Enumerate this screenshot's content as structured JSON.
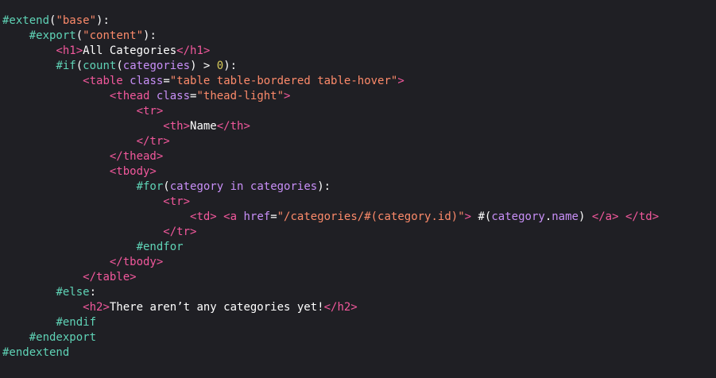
{
  "editor": {
    "background": "#1f1f24",
    "colors": {
      "directive": "#5fd3b6",
      "tag": "#f2589c",
      "string": "#fc8a6a",
      "attribute": "#c88ff7",
      "text": "#ffffff",
      "number": "#d6c85a"
    },
    "lines": [
      [
        [
          "dir",
          "#extend"
        ],
        [
          "pun",
          "("
        ],
        [
          "str",
          "\"base\""
        ],
        [
          "pun",
          "):"
        ]
      ],
      [
        [
          "pun",
          "    "
        ],
        [
          "dir",
          "#export"
        ],
        [
          "pun",
          "("
        ],
        [
          "str",
          "\"content\""
        ],
        [
          "pun",
          "):"
        ]
      ],
      [
        [
          "pun",
          "        "
        ],
        [
          "tag",
          "<h1>"
        ],
        [
          "txt",
          "All Categories"
        ],
        [
          "tag",
          "</h1>"
        ]
      ],
      [
        [
          "pun",
          "        "
        ],
        [
          "dir",
          "#if"
        ],
        [
          "pun",
          "("
        ],
        [
          "dir",
          "count"
        ],
        [
          "pun",
          "("
        ],
        [
          "var",
          "categories"
        ],
        [
          "pun",
          ") > "
        ],
        [
          "num",
          "0"
        ],
        [
          "pun",
          "):"
        ]
      ],
      [
        [
          "pun",
          "            "
        ],
        [
          "tag",
          "<table "
        ],
        [
          "attr",
          "class"
        ],
        [
          "pun",
          "="
        ],
        [
          "str",
          "\"table table-bordered table-hover\""
        ],
        [
          "tag",
          ">"
        ]
      ],
      [
        [
          "pun",
          "                "
        ],
        [
          "tag",
          "<thead "
        ],
        [
          "attr",
          "class"
        ],
        [
          "pun",
          "="
        ],
        [
          "str",
          "\"thead-light\""
        ],
        [
          "tag",
          ">"
        ]
      ],
      [
        [
          "pun",
          "                    "
        ],
        [
          "tag",
          "<tr>"
        ]
      ],
      [
        [
          "pun",
          "                        "
        ],
        [
          "tag",
          "<th>"
        ],
        [
          "txt",
          "Name"
        ],
        [
          "tag",
          "</th>"
        ]
      ],
      [
        [
          "pun",
          "                    "
        ],
        [
          "tag",
          "</tr>"
        ]
      ],
      [
        [
          "pun",
          "                "
        ],
        [
          "tag",
          "</thead>"
        ]
      ],
      [
        [
          "pun",
          "                "
        ],
        [
          "tag",
          "<tbody>"
        ]
      ],
      [
        [
          "pun",
          "                    "
        ],
        [
          "dir",
          "#for"
        ],
        [
          "pun",
          "("
        ],
        [
          "var",
          "category"
        ],
        [
          "pun",
          " "
        ],
        [
          "var",
          "in"
        ],
        [
          "pun",
          " "
        ],
        [
          "var",
          "categories"
        ],
        [
          "pun",
          "):"
        ]
      ],
      [
        [
          "pun",
          "                        "
        ],
        [
          "tag",
          "<tr>"
        ]
      ],
      [
        [
          "pun",
          "                            "
        ],
        [
          "tag",
          "<td>"
        ],
        [
          "pun",
          " "
        ],
        [
          "tag",
          "<a "
        ],
        [
          "attr",
          "href"
        ],
        [
          "pun",
          "="
        ],
        [
          "str",
          "\"/categories/#(category.id)\""
        ],
        [
          "tag",
          ">"
        ],
        [
          "pun",
          " #("
        ],
        [
          "var",
          "category"
        ],
        [
          "pun",
          "."
        ],
        [
          "var",
          "name"
        ],
        [
          "pun",
          ") "
        ],
        [
          "tag",
          "</a>"
        ],
        [
          "pun",
          " "
        ],
        [
          "tag",
          "</td>"
        ]
      ],
      [
        [
          "pun",
          "                        "
        ],
        [
          "tag",
          "</tr>"
        ]
      ],
      [
        [
          "pun",
          "                    "
        ],
        [
          "dir",
          "#endfor"
        ]
      ],
      [
        [
          "pun",
          "                "
        ],
        [
          "tag",
          "</tbody>"
        ]
      ],
      [
        [
          "pun",
          "            "
        ],
        [
          "tag",
          "</table>"
        ]
      ],
      [
        [
          "pun",
          "        "
        ],
        [
          "dir",
          "#else"
        ],
        [
          "pun",
          ":"
        ]
      ],
      [
        [
          "pun",
          "            "
        ],
        [
          "tag",
          "<h2>"
        ],
        [
          "txt",
          "There aren’t any categories yet!"
        ],
        [
          "tag",
          "</h2>"
        ]
      ],
      [
        [
          "pun",
          "        "
        ],
        [
          "dir",
          "#endif"
        ]
      ],
      [
        [
          "pun",
          "    "
        ],
        [
          "dir",
          "#endexport"
        ]
      ],
      [
        [
          "dir",
          "#endextend"
        ]
      ]
    ]
  }
}
